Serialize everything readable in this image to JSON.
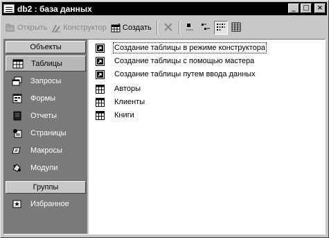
{
  "window": {
    "title": "db2 : база данных",
    "controls": {
      "minimize": "_",
      "maximize": "□",
      "close": "×"
    }
  },
  "toolbar": {
    "open_label": "Открыть",
    "design_label": "Конструктор",
    "new_label": "Создать",
    "delete_icon": "delete-icon",
    "view_buttons": [
      "large-icons-view",
      "small-icons-view",
      "list-view",
      "details-view"
    ]
  },
  "sidebar": {
    "objects_header": "Объекты",
    "groups_header": "Группы",
    "items": [
      {
        "label": "Таблицы",
        "icon": "table-icon",
        "selected": true
      },
      {
        "label": "Запросы",
        "icon": "query-icon"
      },
      {
        "label": "Формы",
        "icon": "form-icon"
      },
      {
        "label": "Отчеты",
        "icon": "report-icon"
      },
      {
        "label": "Страницы",
        "icon": "page-icon"
      },
      {
        "label": "Макросы",
        "icon": "macro-icon"
      },
      {
        "label": "Модули",
        "icon": "module-icon"
      }
    ],
    "groups": [
      {
        "label": "Избранное",
        "icon": "favorites-icon"
      }
    ]
  },
  "list": {
    "items": [
      {
        "label": "Создание таблицы в режиме конструктора",
        "icon": "shortcut-icon",
        "focused": true
      },
      {
        "label": "Создание таблицы с помощью мастера",
        "icon": "shortcut-icon"
      },
      {
        "label": "Создание таблицы путем ввода данных",
        "icon": "shortcut-icon"
      },
      {
        "label": "Авторы",
        "icon": "table-icon"
      },
      {
        "label": "Клиенты",
        "icon": "table-icon"
      },
      {
        "label": "Книги",
        "icon": "table-icon"
      }
    ]
  }
}
